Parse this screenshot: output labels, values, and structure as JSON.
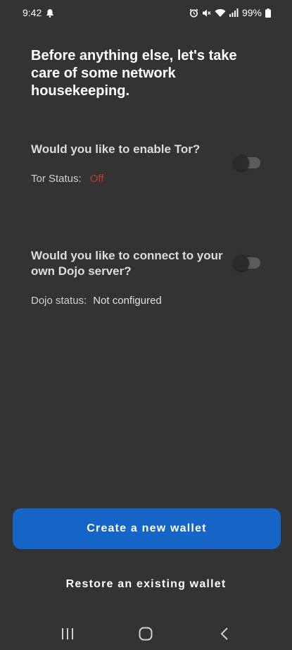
{
  "status_bar": {
    "time": "9:42",
    "battery": "99%"
  },
  "headline": "Before anything else, let's take care of some network housekeeping.",
  "tor": {
    "question": "Would you like to enable Tor?",
    "status_label": "Tor Status:",
    "status_value": "Off",
    "enabled": false
  },
  "dojo": {
    "question": "Would you like to connect to your own Dojo server?",
    "status_label": "Dojo status:",
    "status_value": "Not configured",
    "enabled": false
  },
  "actions": {
    "create_label": "Create a new wallet",
    "restore_label": "Restore an existing wallet"
  },
  "colors": {
    "background": "#333333",
    "primary": "#1565c8",
    "status_off": "#c0392b"
  }
}
